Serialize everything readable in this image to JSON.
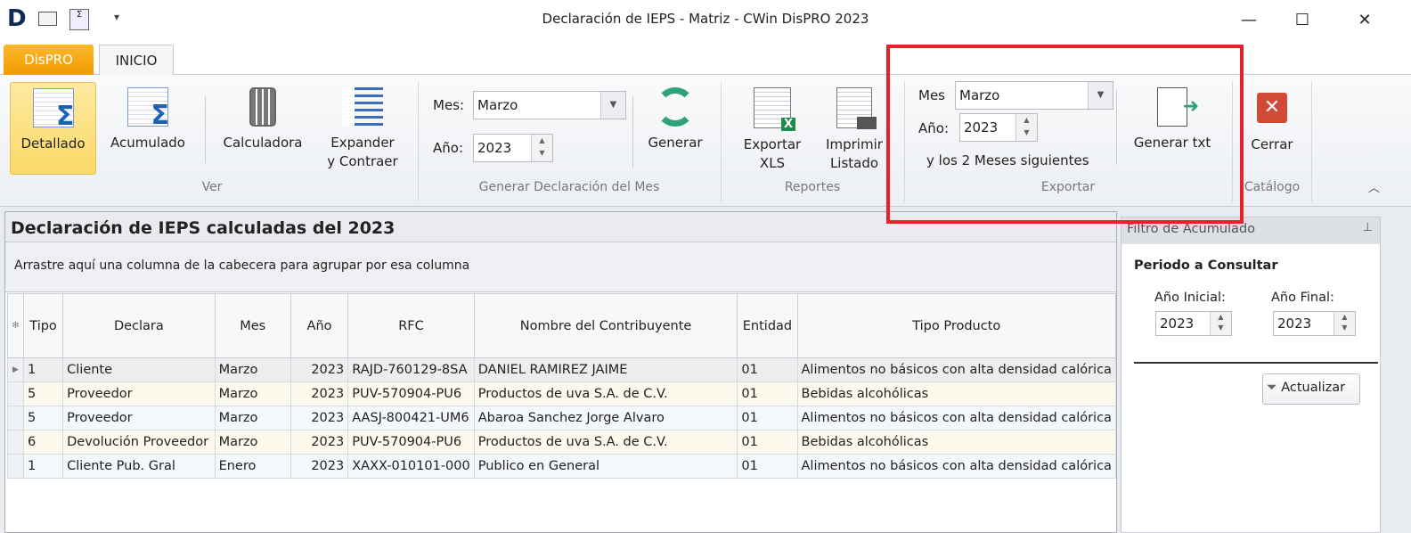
{
  "window": {
    "title": "Declaración de IEPS - Matriz - CWin DisPRO 2023",
    "logo": "D"
  },
  "tabs": [
    "DisPRO",
    "INICIO"
  ],
  "ribbon": {
    "ver": {
      "label": "Ver",
      "buttons": [
        "Detallado",
        "Acumulado",
        "Calculadora",
        "Expander",
        "y Contraer"
      ]
    },
    "generar": {
      "label": "Generar Declaración del Mes",
      "mes_label": "Mes:",
      "mes_value": "Marzo",
      "anio_label": "Año:",
      "anio_value": "2023",
      "button": "Generar"
    },
    "reportes": {
      "label": "Reportes",
      "exportar_l1": "Exportar",
      "exportar_l2": "XLS",
      "imprimir_l1": "Imprimir",
      "imprimir_l2": "Listado"
    },
    "exportar": {
      "label": "Exportar",
      "mes_label": "Mes",
      "mes_value": "Marzo",
      "anio_label": "Año:",
      "anio_value": "2023",
      "note": "y los 2 Meses siguientes",
      "button": "Generar txt"
    },
    "catalogo": {
      "label": "Catálogo",
      "button": "Cerrar"
    }
  },
  "grid": {
    "title": "Declaración de IEPS calculadas del 2023",
    "group_hint": "Arrastre aquí una columna de la cabecera para agrupar por esa columna",
    "columns": [
      "Tipo",
      "Declara",
      "Mes",
      "Año",
      "RFC",
      "Nombre del Contribuyente",
      "Entidad",
      "Tipo Producto"
    ],
    "rows": [
      [
        "1",
        "Cliente",
        "Marzo",
        "2023",
        "RAJD-760129-8SA",
        "DANIEL RAMIREZ JAIME",
        "01",
        "Alimentos no básicos con alta densidad calórica"
      ],
      [
        "5",
        "Proveedor",
        "Marzo",
        "2023",
        "PUV-570904-PU6",
        "Productos de uva S.A. de C.V.",
        "01",
        "Bebidas alcohólicas"
      ],
      [
        "5",
        "Proveedor",
        "Marzo",
        "2023",
        "AASJ-800421-UM6",
        "Abaroa Sanchez Jorge Alvaro",
        "01",
        "Alimentos no básicos con alta densidad calórica"
      ],
      [
        "6",
        "Devolución Proveedor",
        "Marzo",
        "2023",
        "PUV-570904-PU6",
        "Productos de uva S.A. de C.V.",
        "01",
        "Bebidas alcohólicas"
      ],
      [
        "1",
        "Cliente Pub. Gral",
        "Enero",
        "2023",
        "XAXX-010101-000",
        "Publico en General",
        "01",
        "Alimentos no básicos con alta densidad calórica"
      ]
    ]
  },
  "filter": {
    "title": "Filtro de Acumulado",
    "section": "Periodo a Consultar",
    "inicial_label": "Año Inicial:",
    "inicial_value": "2023",
    "final_label": "Año Final:",
    "final_value": "2023",
    "button": "Actualizar"
  },
  "colors": {
    "accent_orange": "#f29a00",
    "highlight": "#e8202a",
    "selected_button": "#fde48a"
  }
}
